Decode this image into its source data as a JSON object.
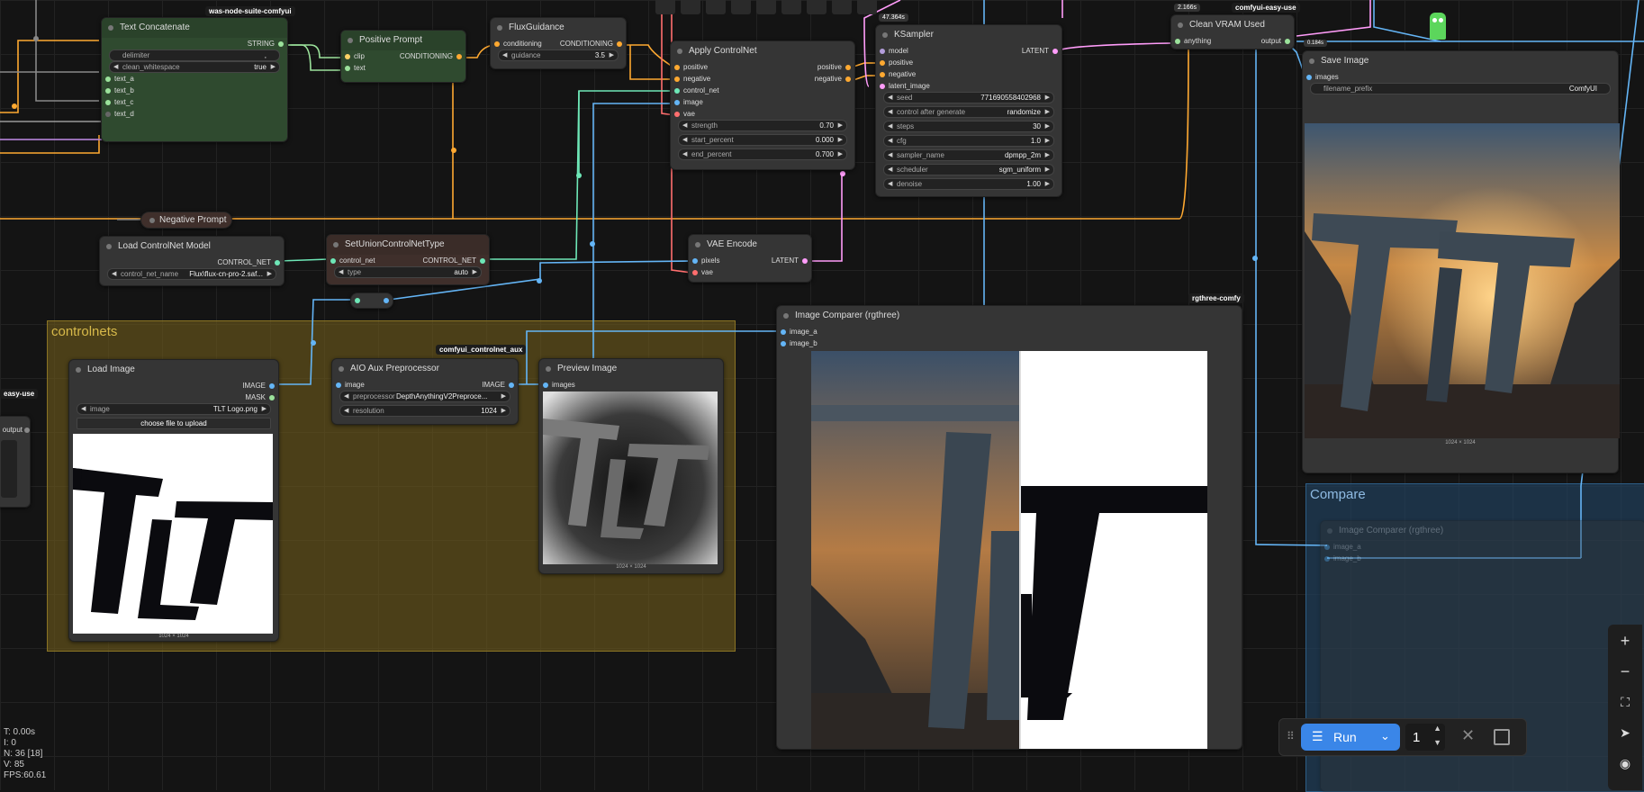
{
  "nodes": {
    "text_concatenate": {
      "badge": "was-node-suite-comfyui",
      "title": "Text Concatenate",
      "output": "STRING",
      "delimiter_label": "delimiter",
      "delimiter_value": ",",
      "clean_label": "clean_whitespace",
      "clean_value": "true",
      "inputs": [
        "text_a",
        "text_b",
        "text_c",
        "text_d"
      ]
    },
    "positive_prompt": {
      "title": "Positive Prompt",
      "inputs": [
        "clip",
        "text"
      ],
      "output": "CONDITIONING"
    },
    "flux_guidance": {
      "title": "FluxGuidance",
      "input": "conditioning",
      "output": "CONDITIONING",
      "widget_label": "guidance",
      "widget_value": "3.5"
    },
    "apply_controlnet": {
      "title": "Apply ControlNet",
      "inputs": [
        "positive",
        "negative",
        "control_net",
        "image",
        "vae"
      ],
      "outputs": [
        "positive",
        "negative"
      ],
      "widgets": [
        {
          "label": "strength",
          "value": "0.70"
        },
        {
          "label": "start_percent",
          "value": "0.000"
        },
        {
          "label": "end_percent",
          "value": "0.700"
        }
      ]
    },
    "ksampler": {
      "timing": "47.364s",
      "title": "KSampler",
      "inputs": [
        "model",
        "positive",
        "negative",
        "latent_image"
      ],
      "output": "LATENT",
      "widgets": [
        {
          "label": "seed",
          "value": "771690558402968"
        },
        {
          "label": "control after generate",
          "value": "randomize"
        },
        {
          "label": "steps",
          "value": "30"
        },
        {
          "label": "cfg",
          "value": "1.0"
        },
        {
          "label": "sampler_name",
          "value": "dpmpp_2m"
        },
        {
          "label": "scheduler",
          "value": "sgm_uniform"
        },
        {
          "label": "denoise",
          "value": "1.00"
        }
      ]
    },
    "clean_vram": {
      "timing": "2.166s",
      "badge": "comfyui-easy-use",
      "title": "Clean VRAM Used",
      "input": "anything",
      "output": "output",
      "sub_timing": "0.184s"
    },
    "save_image": {
      "title": "Save Image",
      "input": "images",
      "widget_label": "filename_prefix",
      "widget_value": "ComfyUI",
      "caption": "1024 × 1024"
    },
    "negative_prompt": {
      "title": "Negative Prompt"
    },
    "load_controlnet": {
      "title": "Load ControlNet Model",
      "output": "CONTROL_NET",
      "widget_label": "control_net_name",
      "widget_value": "Flux\\flux-cn-pro-2.saf..."
    },
    "set_union": {
      "title": "SetUnionControlNetType",
      "input": "control_net",
      "output": "CONTROL_NET",
      "widget_label": "type",
      "widget_value": "auto"
    },
    "vae_encode": {
      "title": "VAE Encode",
      "inputs": [
        "pixels",
        "vae"
      ],
      "output": "LATENT"
    },
    "image_comparer": {
      "badge": "rgthree-comfy",
      "title": "Image Comparer (rgthree)",
      "inputs": [
        "image_a",
        "image_b"
      ]
    },
    "load_image": {
      "title": "Load Image",
      "outputs": [
        "IMAGE",
        "MASK"
      ],
      "widget_label": "image",
      "widget_value": "TLT Logo.png",
      "upload_label": "choose file to upload",
      "caption": "1024 × 1024"
    },
    "aio_aux": {
      "badge": "comfyui_controlnet_aux",
      "title": "AIO Aux Preprocessor",
      "input": "image",
      "output": "IMAGE",
      "widgets": [
        {
          "label": "preprocessor",
          "value": "DepthAnythingV2Preproce..."
        },
        {
          "label": "resolution",
          "value": "1024"
        }
      ]
    },
    "preview_image": {
      "title": "Preview Image",
      "input": "images",
      "caption": "1024 × 1024"
    },
    "compare_comparer": {
      "title": "Image Comparer (rgthree)",
      "inputs": [
        "image_a",
        "image_b"
      ]
    },
    "left_partial": {
      "badge": "easy-use",
      "output": "output"
    }
  },
  "groups": {
    "controlnets": "controlnets",
    "compare": "Compare"
  },
  "logo_text": "TLT",
  "toolbar": {
    "run_label": "Run",
    "batch_count": "1"
  },
  "stats": {
    "t": "T: 0.00s",
    "i": "I: 0",
    "n": "N: 36 [18]",
    "v": "V: 85",
    "fps": "FPS:60.61"
  },
  "colors": {
    "accent": "#3a86e8",
    "group_controlnets": "#6b5a1e",
    "group_compare": "#1f3a55",
    "wire_string": "#9be29b",
    "wire_image": "#64b5f6",
    "wire_conditioning": "#ffa931",
    "wire_latent": "#ff9cf9",
    "wire_vae": "#ff6e6e",
    "wire_controlnet": "#6ee7b7"
  }
}
